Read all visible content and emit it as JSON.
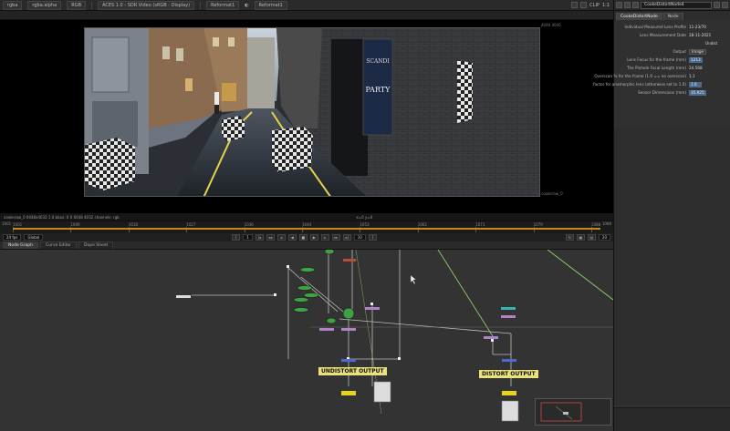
{
  "viewer_toolbar": {
    "layer": "rgba",
    "channel": "rgba.alpha",
    "colorspace": "RGB",
    "display": "ACES 1.0 - SDR Video (sRGB - Display)",
    "input_a": "Reformat1",
    "input_b": "Reformat1",
    "clip": "CLIP",
    "zoom": "1:1"
  },
  "viewer": {
    "bbox_label_top": "4040 4040",
    "bbox_label_bottom": "cookeraw_0",
    "poster": {
      "line1": "SCANDI",
      "line2": "PARTY"
    }
  },
  "viewer_info": {
    "left": "cookeraw_0 6048x4032 1.0   bbox: 0 0 6048 4032 channels: rgb",
    "center": "x=0 y=0"
  },
  "timeline": {
    "ticks": [
      "1001",
      "1009",
      "1018",
      "1027",
      "1036",
      "1044",
      "1053",
      "1062",
      "1071",
      "1079",
      "1088"
    ],
    "start": "1001",
    "end": "1088"
  },
  "playback": {
    "fps": "24 fps",
    "mode": "Global",
    "frame": "1",
    "step": "10",
    "speed": "20"
  },
  "graph_tabs": [
    "Node Graph",
    "Curve Editor",
    "Dope Sheet"
  ],
  "nodes": {
    "undistort_label": "UNDISTORT OUTPUT",
    "distort_label": "DISTORT OUTPUT"
  },
  "properties": {
    "node_name": "CookeDistortNode4",
    "tabs": [
      "CookeDistortNode",
      "Node"
    ],
    "rows": [
      {
        "label": "Individual Measured Lens Profile",
        "value": "11-23/70"
      },
      {
        "label": "Lens Measurement Date",
        "value": "28-11-2021"
      },
      {
        "label": "",
        "value": "Undist"
      },
      {
        "label": "Output",
        "value": "Image"
      },
      {
        "label": "Lens Focus for the frame (mm)",
        "value": "1213"
      },
      {
        "label": "The Pinhole Focal Length (mm)",
        "value": "24.568"
      },
      {
        "label": "Overscan % for the frame (1.0 == no overscan)",
        "value": "1.1"
      },
      {
        "label": "factor for anamorphic lens (otherwise set to 1.0)",
        "value": "1.6"
      },
      {
        "label": "Sensor Dimensions (mm)",
        "value": "35.925"
      }
    ]
  },
  "colors": {
    "accent_timeline": "#c58a1a",
    "label_yellow": "#e9e27a",
    "field_blue": "#4a6a8e",
    "graph_bg": "#333333"
  }
}
